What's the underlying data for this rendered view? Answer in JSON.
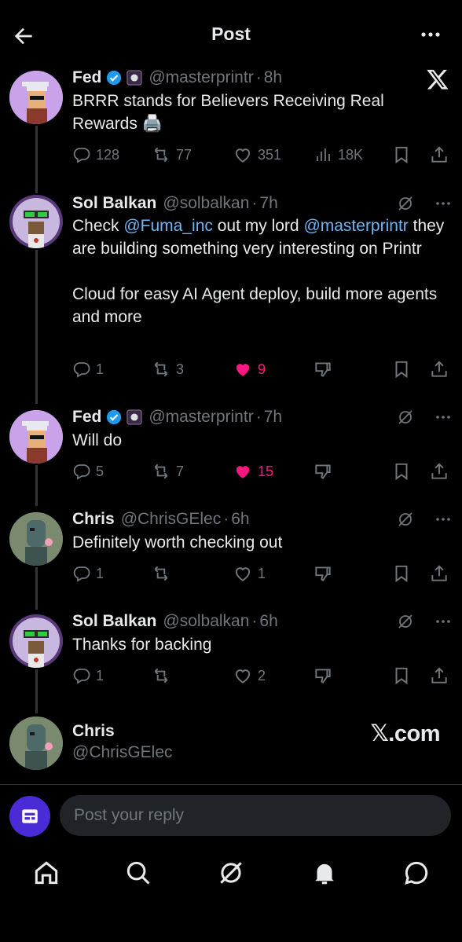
{
  "header": {
    "title": "Post"
  },
  "posts": [
    {
      "name": "Fed",
      "handle": "@masterprintr",
      "time": "8h",
      "text": "BRRR stands for Believers Receiving Real Rewards 🖨️",
      "replies": "128",
      "reposts": "77",
      "likes": "351",
      "views": "18K"
    },
    {
      "name": "Sol Balkan",
      "handle": "@solbalkan",
      "time": "7h",
      "text_check": "Check ",
      "mention1": "@Fuma_inc",
      "text_mid": " out my lord ",
      "mention2": "@masterprintr",
      "text_rest": " they are building something very interesting on Printr",
      "text_p2": "Cloud for easy AI Agent deploy, build more agents and more",
      "replies": "1",
      "reposts": "3",
      "likes": "9"
    },
    {
      "name": "Fed",
      "handle": "@masterprintr",
      "time": "7h",
      "text": "Will do",
      "replies": "5",
      "reposts": "7",
      "likes": "15"
    },
    {
      "name": "Chris",
      "handle": "@ChrisGElec",
      "time": "6h",
      "text": "Definitely worth checking out",
      "replies": "1",
      "reposts": "",
      "likes": "1"
    },
    {
      "name": "Sol Balkan",
      "handle": "@solbalkan",
      "time": "6h",
      "text": "Thanks for backing",
      "replies": "1",
      "reposts": "",
      "likes": "2"
    }
  ],
  "author_card": {
    "name": "Chris",
    "handle": "@ChrisGElec",
    "watermark": "𝕏.com"
  },
  "reply_bar": {
    "placeholder": "Post your reply"
  },
  "tabbar": {
    "items": [
      "home-icon",
      "search-icon",
      "grok-icon",
      "notifications-icon",
      "messages-icon"
    ]
  },
  "colors": {
    "like": "#f91880",
    "mention": "#6fb4f4",
    "verified": "#1d9bf0",
    "muted": "#71767b"
  }
}
